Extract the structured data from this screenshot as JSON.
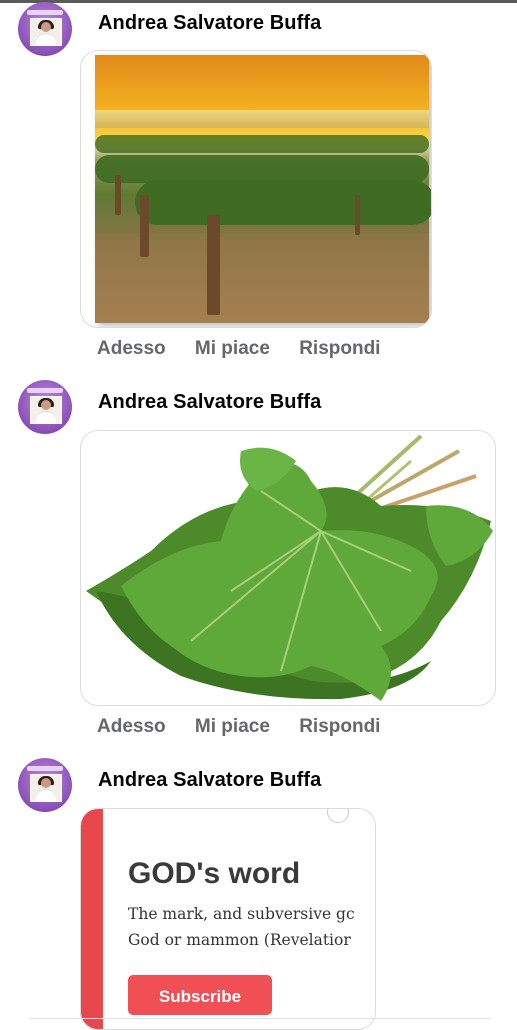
{
  "comments": [
    {
      "author": "Andrea Salvatore Buffa",
      "media": "vineyard-photo",
      "actions": {
        "time": "Adesso",
        "like": "Mi piace",
        "reply": "Rispondi"
      }
    },
    {
      "author": "Andrea Salvatore Buffa",
      "media": "grape-leaves-photo",
      "actions": {
        "time": "Adesso",
        "like": "Mi piace",
        "reply": "Rispondi"
      }
    },
    {
      "author": "Andrea Salvatore Buffa",
      "media": "ad-card",
      "ad": {
        "title": "GOD's word",
        "line1": "The mark, and subversive gc",
        "line2": "God or mammon (Revelatior",
        "button": "Subscribe"
      }
    }
  ],
  "colors": {
    "accent_red": "#ef4f55",
    "action_gray": "#65676b",
    "avatar_purple": "#8a4fb8"
  }
}
